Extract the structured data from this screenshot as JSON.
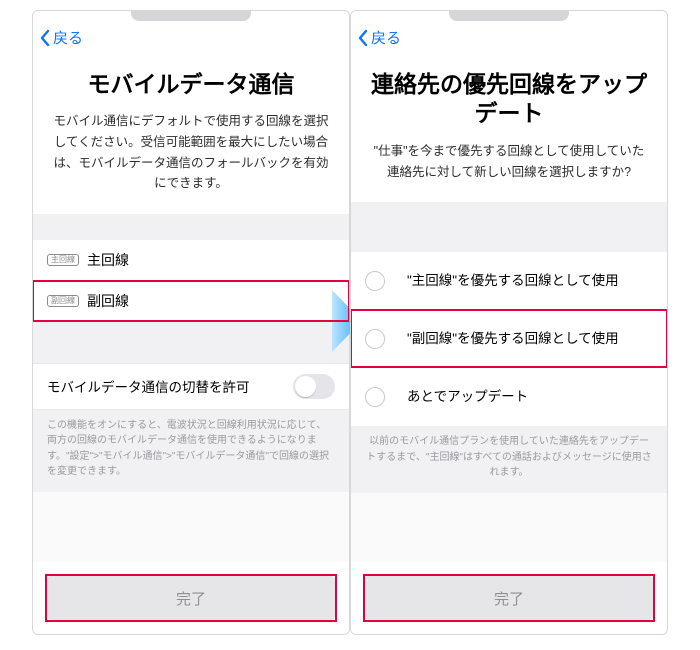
{
  "nav": {
    "back": "戻る"
  },
  "colors": {
    "accent": "#0b74ff",
    "highlight": "#e4003f"
  },
  "left": {
    "title": "モバイルデータ通信",
    "desc": "モバイル通信にデフォルトで使用する回線を選択してください。受信可能範囲を最大にしたい場合は、モバイルデータ通信のフォールバックを有効にできます。",
    "rows": [
      {
        "badge": "主回線",
        "label": "主回線"
      },
      {
        "badge": "副回線",
        "label": "副回線"
      }
    ],
    "toggle_label": "モバイルデータ通信の切替を許可",
    "toggle_on": false,
    "help": "この機能をオンにすると、電波状況と回線利用状況に応じて、両方の回線のモバイルデータ通信を使用できるようになります。\"設定\">\"モバイル通信\">\"モバイルデータ通信\"で回線の選択を変更できます。",
    "button": "完了"
  },
  "right": {
    "title": "連絡先の優先回線をアップデート",
    "desc": "\"仕事\"を今まで優先する回線として使用していた連絡先に対して新しい回線を選択しますか?",
    "options": [
      "\"主回線\"を優先する回線として使用",
      "\"副回線\"を優先する回線として使用",
      "あとでアップデート"
    ],
    "help": "以前のモバイル通信プランを使用していた連絡先をアップデートするまで、\"主回線\"はすべての通話およびメッセージに使用されます。",
    "button": "完了"
  }
}
